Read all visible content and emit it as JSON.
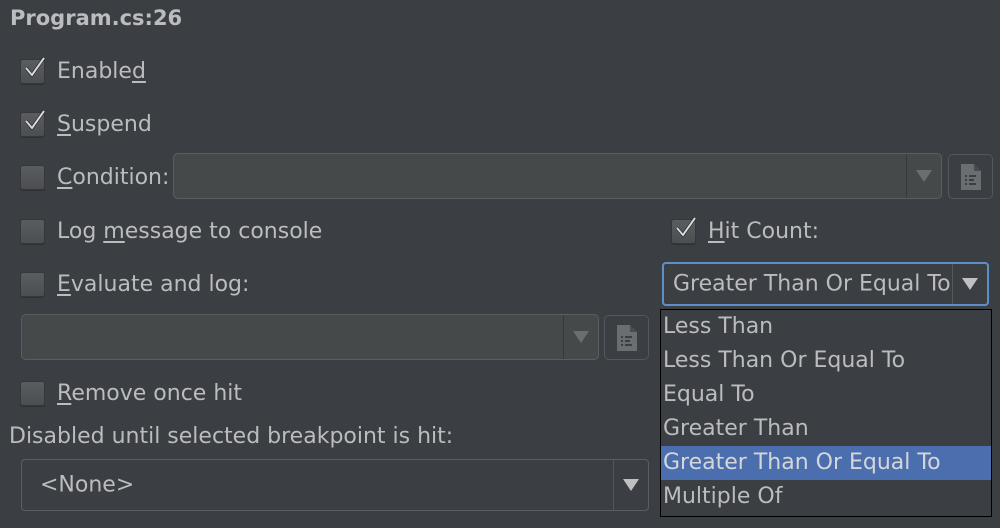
{
  "title": "Program.cs:26",
  "options": {
    "enabled": {
      "pre": "Enable",
      "mnemonic": "d",
      "post": "",
      "checked": true
    },
    "suspend": {
      "pre": "",
      "mnemonic": "S",
      "post": "uspend",
      "checked": true
    },
    "condition": {
      "pre": "",
      "mnemonic": "C",
      "post": "ondition:",
      "checked": false,
      "value": ""
    },
    "log_message": {
      "pre": "Log ",
      "mnemonic": "m",
      "post": "essage to console",
      "checked": false
    },
    "evaluate_log": {
      "pre": "",
      "mnemonic": "E",
      "post": "valuate and log:",
      "checked": false,
      "value": ""
    },
    "remove_once_hit": {
      "pre": "",
      "mnemonic": "R",
      "post": "emove once hit",
      "checked": false
    },
    "hit_count": {
      "pre": "",
      "mnemonic": "H",
      "post": "it Count:",
      "checked": true
    }
  },
  "hit_count_combo": {
    "selected": "Greater Than Or Equal To",
    "options": [
      "Less Than",
      "Less Than Or Equal To",
      "Equal To",
      "Greater Than",
      "Greater Than Or Equal To",
      "Multiple Of"
    ],
    "selected_index": 4
  },
  "disabled_until": {
    "label": "Disabled until selected breakpoint is hit:",
    "selected": "<None>"
  },
  "colors": {
    "background": "#3b3e42",
    "text": "#bbbcbd",
    "selection": "#4b6eaf",
    "focus_border": "#5f8fc9"
  }
}
